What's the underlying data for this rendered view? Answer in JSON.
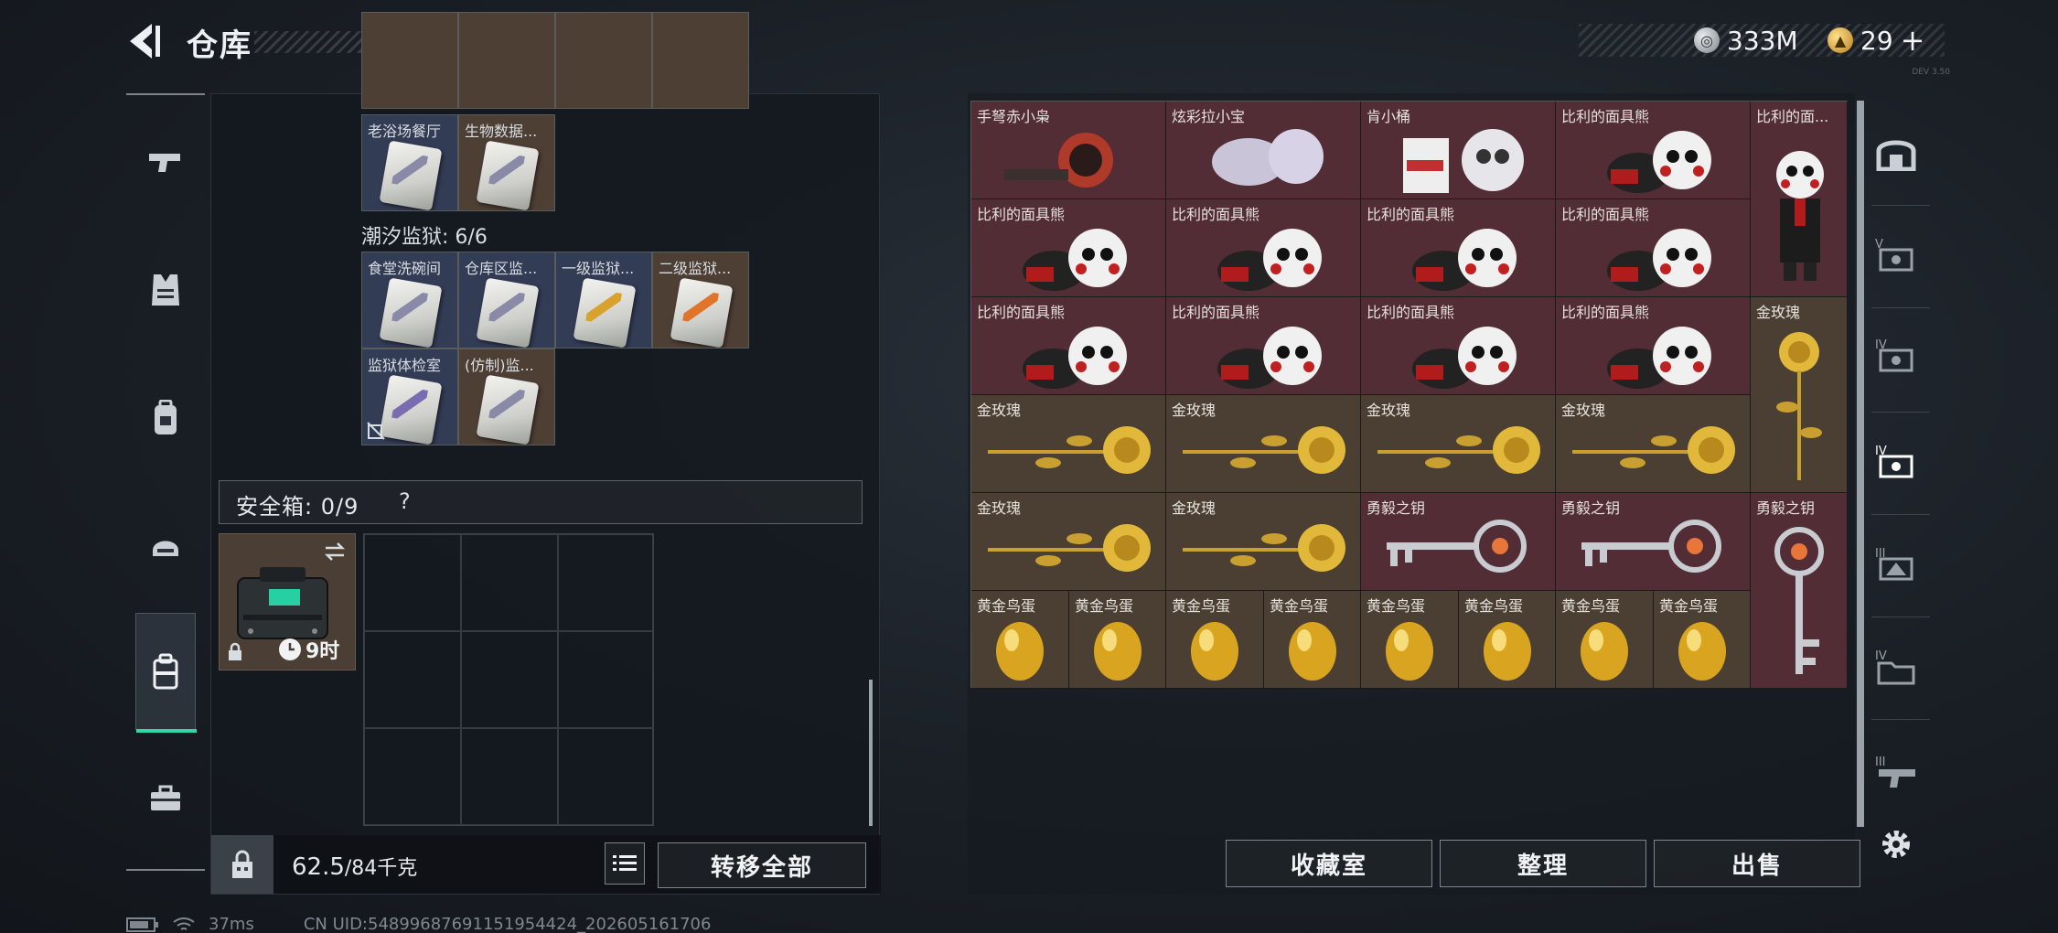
{
  "header": {
    "title": "仓库",
    "currency_primary": "333M",
    "currency_secondary": "29",
    "currency_add": "+",
    "version": "DEV 3.50"
  },
  "left_nav": {
    "items": [
      "weapons-icon",
      "armor-icon",
      "backpack-icon",
      "helmet-icon",
      "safe-box-icon",
      "briefcase-icon"
    ],
    "active_index": 4
  },
  "left_panel": {
    "top_group": {
      "items": [
        {
          "label": "老浴场餐厅",
          "band": "#8a8aa8"
        },
        {
          "label": "生物数据...",
          "band": "#8a8aa8"
        }
      ]
    },
    "prison_group": {
      "title": "潮汐监狱: 6/6",
      "items": [
        {
          "label": "食堂洗碗间",
          "band": "#8a8aa8"
        },
        {
          "label": "仓库区监...",
          "band": "#8a8aa8"
        },
        {
          "label": "一级监狱...",
          "band": "#d9a22e"
        },
        {
          "label": "二级监狱...",
          "band": "#e0752a"
        },
        {
          "label": "监狱体检室",
          "band": "#7a6cb0"
        },
        {
          "label": "(仿制)监...",
          "band": "#8a8aa8"
        }
      ]
    },
    "safe_box": {
      "title": "安全箱: 0/9",
      "help": "?",
      "timer": "9时"
    },
    "capacity": {
      "current": "62.5",
      "max": "/84千克"
    },
    "transfer_all_label": "转移全部"
  },
  "right_storage": {
    "rows": [
      [
        {
          "label": "手弩赤小枭",
          "kind": "red"
        },
        {
          "label": "炫彩拉小宝",
          "kind": "red"
        },
        {
          "label": "肯小桶",
          "kind": "red"
        },
        {
          "label": "比利的面具熊",
          "kind": "red"
        },
        {
          "label": "比利的面...",
          "kind": "red"
        }
      ],
      [
        {
          "label": "比利的面具熊",
          "kind": "red"
        },
        {
          "label": "比利的面具熊",
          "kind": "red"
        },
        {
          "label": "比利的面具熊",
          "kind": "red"
        },
        {
          "label": "比利的面具熊",
          "kind": "red"
        }
      ],
      [
        {
          "label": "比利的面具熊",
          "kind": "red"
        },
        {
          "label": "比利的面具熊",
          "kind": "red"
        },
        {
          "label": "比利的面具熊",
          "kind": "red"
        },
        {
          "label": "比利的面具熊",
          "kind": "red"
        },
        {
          "label": "金玫瑰",
          "kind": "gold"
        }
      ],
      [
        {
          "label": "金玫瑰",
          "kind": "gold"
        },
        {
          "label": "金玫瑰",
          "kind": "gold"
        },
        {
          "label": "金玫瑰",
          "kind": "gold"
        },
        {
          "label": "金玫瑰",
          "kind": "gold"
        }
      ],
      [
        {
          "label": "金玫瑰",
          "kind": "gold"
        },
        {
          "label": "金玫瑰",
          "kind": "gold"
        },
        {
          "label": "勇毅之钥",
          "kind": "red"
        },
        {
          "label": "勇毅之钥",
          "kind": "red"
        },
        {
          "label": "勇毅之钥",
          "kind": "red"
        }
      ],
      [
        {
          "label": "黄金鸟蛋",
          "kind": "gold"
        },
        {
          "label": "黄金鸟蛋",
          "kind": "gold"
        },
        {
          "label": "黄金鸟蛋",
          "kind": "gold"
        },
        {
          "label": "黄金鸟蛋",
          "kind": "gold"
        },
        {
          "label": "黄金鸟蛋",
          "kind": "gold"
        },
        {
          "label": "黄金鸟蛋",
          "kind": "gold"
        },
        {
          "label": "黄金鸟蛋",
          "kind": "gold"
        },
        {
          "label": "黄金鸟蛋",
          "kind": "gold"
        }
      ]
    ]
  },
  "right_nav": {
    "items": [
      "home-icon",
      "tier-v-storage-icon",
      "tier-iv-storage-icon",
      "tier-iv-storage-selected-icon",
      "tier-iii-storage-icon",
      "tier-iv-folder-icon",
      "tier-iii-gun-icon"
    ]
  },
  "actions": {
    "collection_label": "收藏室",
    "sort_label": "整理",
    "sell_label": "出售"
  },
  "status_bar": {
    "ping": "37ms",
    "uid": "CN UID:5489968769115195442​4_202605161706"
  }
}
